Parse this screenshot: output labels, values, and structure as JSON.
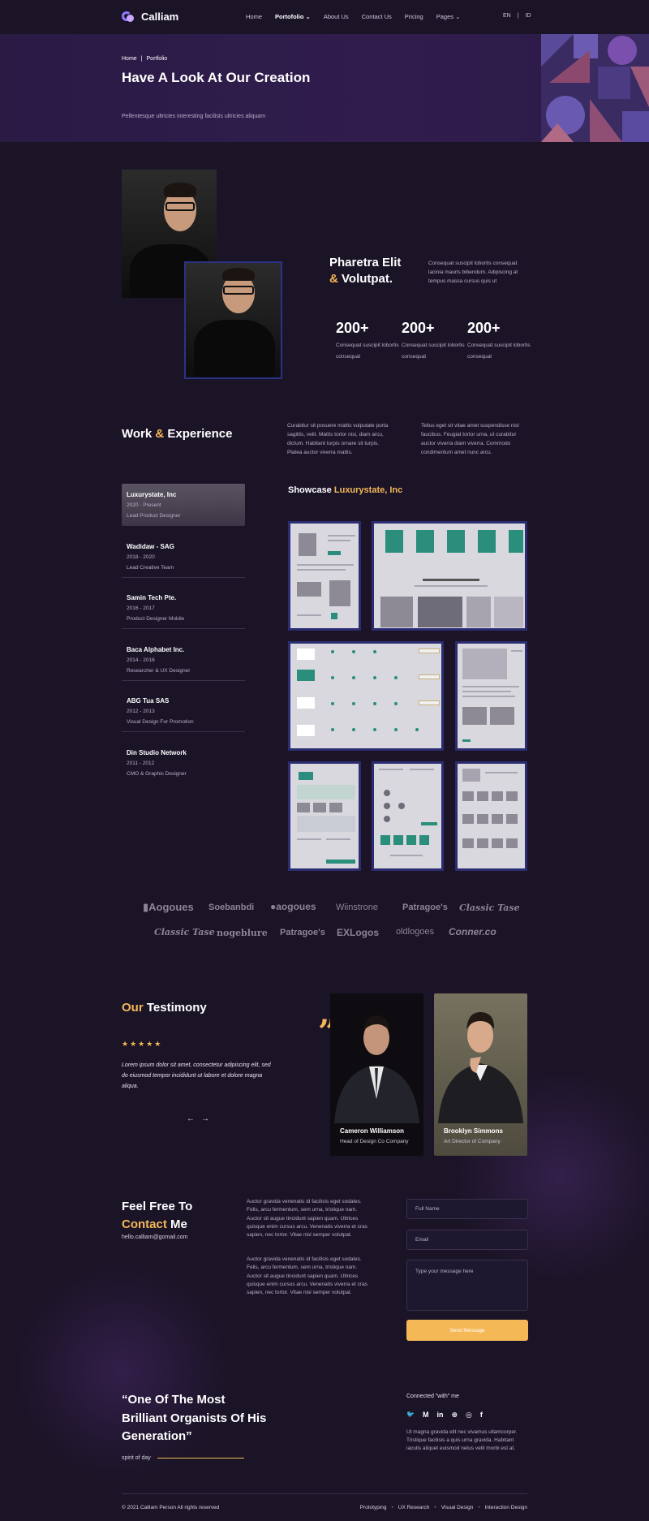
{
  "nav": {
    "brand": "Calliam",
    "items": [
      "Home",
      "Portofolio",
      "About Us",
      "Contact Us",
      "Pricing",
      "Pages"
    ],
    "lang_en": "EN",
    "lang_sep": "|",
    "lang_id": "ID"
  },
  "hero": {
    "crumb_home": "Home",
    "crumb_sep": "|",
    "crumb_current": "Portfolio",
    "title": "Have A Look At Our Creation",
    "subtitle": "Pellentesque ultricies interesting facilisis ultricies aliquam"
  },
  "about": {
    "title_1": "Pharetra Elit",
    "title_amp": "&",
    "title_2": "Volutpat.",
    "desc": "Consequat suscipit lobortis consequat lacinia mauris bibendum. Adipiscing at tempus massa cursus quis ut",
    "stats": [
      {
        "num": "200+",
        "label": "Consequat suscipit lobortis consequat"
      },
      {
        "num": "200+",
        "label": "Consequat suscipit lobortis consequat"
      },
      {
        "num": "200+",
        "label": "Consequat suscipit lobortis consequat"
      }
    ]
  },
  "work": {
    "title_1": "Work",
    "title_amp": "&",
    "title_2": "Experience",
    "p1": "Curabitur sit posuere mattis vulputate porta sagittis, velit. Mattis tortor nisi, diam arcu, dictum. Habitant turpis ornare sit turpis. Platea auctor viverra mattis.",
    "p2": "Tellus eget sit vitae amet suspendisse nisl faucibus. Feugiat tortor urna, ut curabitur auctor viverra diam viverra. Commodo condimentum amet nunc arcu.",
    "jobs": [
      {
        "company": "Luxurystate, Inc",
        "years": "2020 - Present",
        "role": "Lead Product Designer"
      },
      {
        "company": "Wadidaw - SAG",
        "years": "2018 - 2020",
        "role": "Lead Creative Team"
      },
      {
        "company": "Samin Tech Pte.",
        "years": "2016 - 2017",
        "role": "Product Designer Mobile"
      },
      {
        "company": "Baca Alphabet Inc.",
        "years": "2014 - 2016",
        "role": "Researcher & UX Designer"
      },
      {
        "company": "ABG Tua SAS",
        "years": "2012 - 2013",
        "role": "Visual Design For Promotion"
      },
      {
        "company": "Din Studio Network",
        "years": "2011 - 2012",
        "role": "CMO & Graphic Designer"
      }
    ],
    "showcase_label": "Showcase",
    "showcase_company": "Luxurystate, Inc"
  },
  "brands": [
    "Aogoues",
    "Soebanbdi",
    "aogoues",
    "Wiinstrone",
    "Patragoe's",
    "Classic Tase",
    "Classic Tase",
    "nogeblure",
    "Patragoe's",
    "EXLogos",
    "oldlogoes",
    "Conner.co"
  ],
  "testimony": {
    "title_1": "Our",
    "title_2": "Testimony",
    "stars": "★★★★★",
    "rating": 5,
    "quote": "Lorem ipsum dolor sit amet, consectetur adipiscing elit, sed do eiusmod tempor incididunt ut labore et dolore magna aliqua.",
    "prev": "←",
    "next": "→",
    "quote_mark": "”",
    "people": [
      {
        "name": "Cameron Williamson",
        "role": "Head of Design Co Company"
      },
      {
        "name": "Brooklyn Simmons",
        "role": "Art Director of Company"
      }
    ]
  },
  "contact": {
    "title_1": "Feel Free To",
    "title_accent": "Contact",
    "title_2": "Me",
    "email": "hello.calliam@gomail.com",
    "p1": "Auctor gravida venenatis id facilisis eget sodales. Felis, arcu fermentum, sem urna, tristique nam. Auctor sit augue tincidunt sapien quam. Ultrices quisque enim cursus arcu. Venenatis viverra et cras sapien, nec tortor. Vitae nisl semper volutpat.",
    "p2": "Auctor gravida venenatis id facilisis eget sodales. Felis, arcu fermentum, sem urna, tristique nam. Auctor sit augue tincidunt sapien quam. Ultrices quisque enim cursus arcu. Venenatis viverra et cras sapien, nec tortor. Vitae nisl semper volutpat.",
    "name_placeholder": "Full Name",
    "email_placeholder": "Email",
    "message_placeholder": "Type your message here",
    "send_label": "Send Message"
  },
  "quote_section": {
    "quote": "“One Of The Most Brilliant Organists Of His Generation”",
    "source": "spirit of day",
    "connected": "Connected \"with\" me",
    "social_icons": [
      "twitter-icon",
      "medium-icon",
      "linkedin-icon",
      "dribbble-icon",
      "instagram-icon",
      "facebook-icon"
    ],
    "social_glyphs": [
      "🐦",
      "M",
      "in",
      "⊛",
      "◎",
      "f"
    ],
    "social_text": "Ut magna gravida elit nec vivamus ullamcorper. Tristique facilisis a quis urna gravida. Habitant iaculis aliquet euismod netus velit morbi est at."
  },
  "footer": {
    "copyright": "© 2021 Calliam Person All rights reserved",
    "links": [
      "Prototyping",
      "UX Research",
      "Visual Design",
      "Interaction Design"
    ],
    "sep": "•"
  },
  "colors": {
    "background": "#1b1427",
    "accent": "#f4b857",
    "hero": "#2e1c4b",
    "tile_border": "#2b2c72"
  }
}
